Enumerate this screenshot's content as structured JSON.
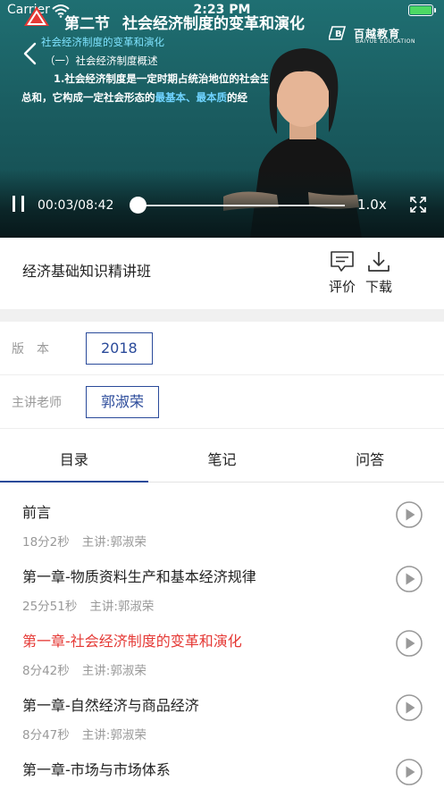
{
  "status_bar": {
    "carrier": "Carrier",
    "time": "2:23 PM"
  },
  "video": {
    "slide": {
      "section": "第二节",
      "title": "社会经济制度的变革和演化",
      "subtitle": "社会经济制度的变革和演化",
      "subsection": "（一）社会经济制度概述",
      "line1": "1.社会经济制度是一定时期占统治地位的社会生",
      "line2_prefix": "总和，它构成一定社会形态的",
      "line2_highlight": "最基本、最本质",
      "line2_suffix": "的经",
      "logo_cn": "百越教育",
      "logo_en": "BAIYUE EDUCATION"
    },
    "controls": {
      "time": "00:03/08:42",
      "speed": "1.0x",
      "progress": 0.006
    }
  },
  "course": {
    "title": "经济基础知识精讲班",
    "actions": {
      "review": "评价",
      "download": "下载"
    }
  },
  "meta": {
    "version_label": "版本",
    "version_value": "2018",
    "teacher_label": "主讲老师",
    "teacher_value": "郭淑荣"
  },
  "tabs": [
    "目录",
    "笔记",
    "问答"
  ],
  "active_tab": 0,
  "lessons": [
    {
      "title": "前言",
      "duration": "18分2秒",
      "lecturer": "主讲:郭淑荣",
      "current": false
    },
    {
      "title": "第一章-物质资料生产和基本经济规律",
      "duration": "25分51秒",
      "lecturer": "主讲:郭淑荣",
      "current": false
    },
    {
      "title": "第一章-社会经济制度的变革和演化",
      "duration": "8分42秒",
      "lecturer": "主讲:郭淑荣",
      "current": true
    },
    {
      "title": "第一章-自然经济与商品经济",
      "duration": "8分47秒",
      "lecturer": "主讲:郭淑荣",
      "current": false
    },
    {
      "title": "第一章-市场与市场体系",
      "duration": "",
      "lecturer": "",
      "current": false
    }
  ],
  "colors": {
    "accent": "#2a4a9a",
    "current_lesson": "#e53935",
    "video_bg": "#1a5d61"
  }
}
